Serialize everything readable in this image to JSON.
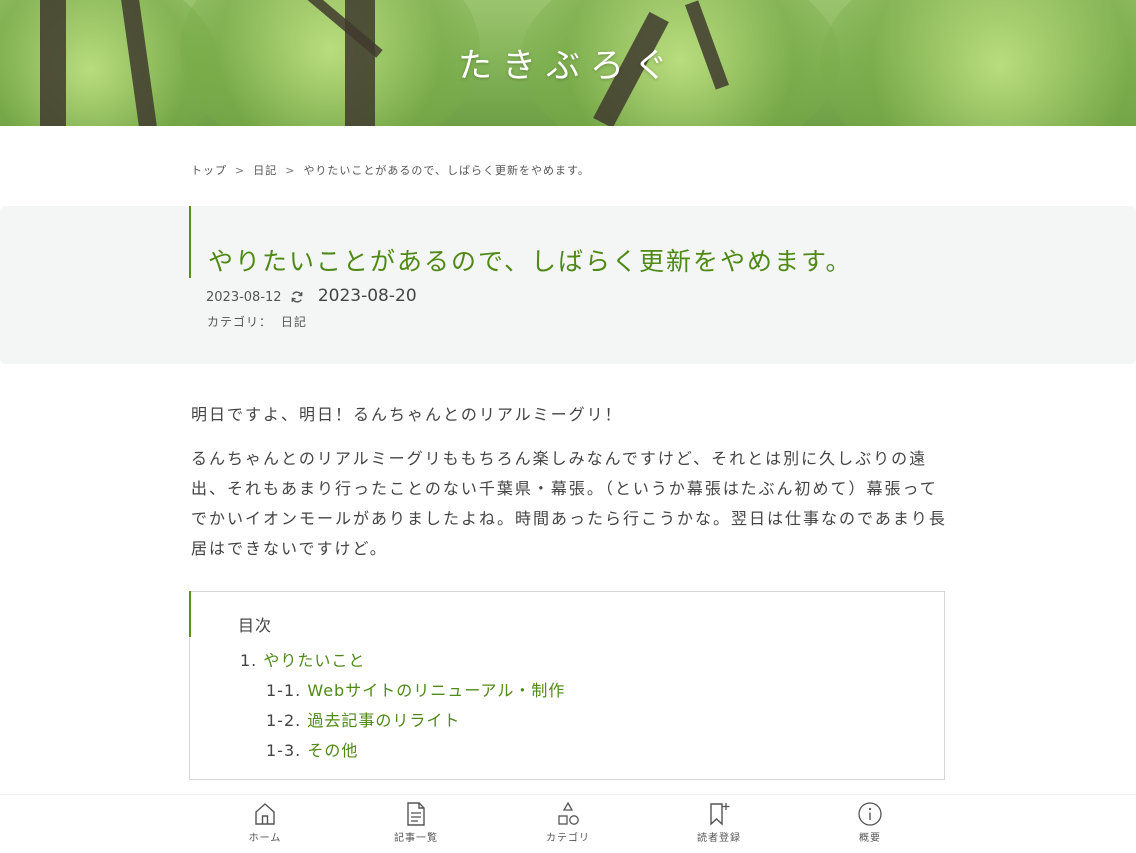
{
  "site": {
    "title": "たきぶろぐ"
  },
  "breadcrumb": {
    "items": [
      "トップ",
      "日記",
      "やりたいことがあるので、しばらく更新をやめます。"
    ],
    "separator": ">"
  },
  "article": {
    "title": "やりたいことがあるので、しばらく更新をやめます。",
    "published": "2023-08-12",
    "updated": "2023-08-20",
    "category_label": "カテゴリ：",
    "category": "日記",
    "paragraphs": [
      "明日ですよ、明日！るんちゃんとのリアルミーグリ！",
      "るんちゃんとのリアルミーグリももちろん楽しみなんですけど、それとは別に久しぶりの遠出、それもあまり行ったことのない千葉県・幕張。（というか幕張はたぶん初めて）幕張ってでかいイオンモールがありましたよね。時間あったら行こうかな。翌日は仕事なのであまり長居はできないですけど。"
    ]
  },
  "toc": {
    "title": "目次",
    "items": [
      {
        "num": "1.",
        "label": "やりたいこと"
      },
      {
        "num": "1-1.",
        "label": "Webサイトのリニューアル・制作"
      },
      {
        "num": "1-2.",
        "label": "過去記事のリライト"
      },
      {
        "num": "1-3.",
        "label": "その他"
      }
    ]
  },
  "bottom_nav": {
    "items": [
      {
        "label": "ホーム",
        "icon": "home-icon"
      },
      {
        "label": "記事一覧",
        "icon": "document-icon"
      },
      {
        "label": "カテゴリ",
        "icon": "shapes-icon"
      },
      {
        "label": "読者登録",
        "icon": "bookmark-add-icon"
      },
      {
        "label": "概要",
        "icon": "info-icon"
      }
    ]
  },
  "colors": {
    "accent": "#4f8a17",
    "panel": "#f4f5f5"
  }
}
